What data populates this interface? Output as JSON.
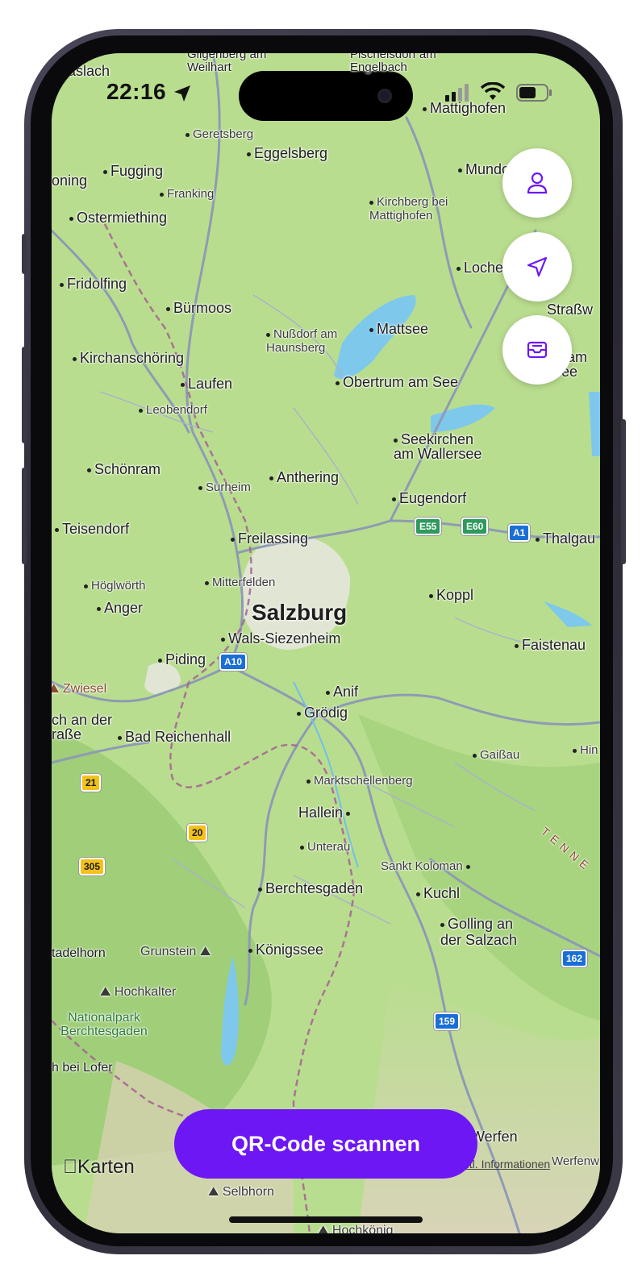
{
  "status_bar": {
    "time": "22:16"
  },
  "map": {
    "main_city": "Salzburg",
    "places": [
      {
        "name": "Mattighofen"
      },
      {
        "name": "Geretsberg"
      },
      {
        "name": "Eggelsberg"
      },
      {
        "name": "Fugging"
      },
      {
        "name": "Franking"
      },
      {
        "name": "Ostermiething"
      },
      {
        "name": "Kirchberg bei Mattighofen"
      },
      {
        "name": "Fridolfing"
      },
      {
        "name": "Bürmoos"
      },
      {
        "name": "Nußdorf am Haunsberg"
      },
      {
        "name": "Mattsee"
      },
      {
        "name": "Kirchanschöring"
      },
      {
        "name": "Laufen"
      },
      {
        "name": "Obertrum am See"
      },
      {
        "name": "Leobendorf"
      },
      {
        "name": "Seekirchen am Wallersee"
      },
      {
        "name": "Schönram"
      },
      {
        "name": "Surheim"
      },
      {
        "name": "Anthering"
      },
      {
        "name": "Eugendorf"
      },
      {
        "name": "Teisendorf"
      },
      {
        "name": "Freilassing"
      },
      {
        "name": "Thalgau"
      },
      {
        "name": "Höglwörth"
      },
      {
        "name": "Mitterfelden"
      },
      {
        "name": "Koppl"
      },
      {
        "name": "Anger"
      },
      {
        "name": "Wals-Siezenheim"
      },
      {
        "name": "Faistenau"
      },
      {
        "name": "Piding"
      },
      {
        "name": "Anif"
      },
      {
        "name": "Grödig"
      },
      {
        "name": "Bad Reichenhall"
      },
      {
        "name": "Gaißau"
      },
      {
        "name": "Marktschellenberg"
      },
      {
        "name": "Hallein"
      },
      {
        "name": "Unterau"
      },
      {
        "name": "Sankt Koloman"
      },
      {
        "name": "Berchtesgaden"
      },
      {
        "name": "Kuchl"
      },
      {
        "name": "Golling an der Salzach"
      },
      {
        "name": "Königssee"
      },
      {
        "name": "Werfen"
      }
    ],
    "peaks": [
      "Zwiesel",
      "Grunstein",
      "Hochkalter",
      "Selbhorn",
      "Hochkönig"
    ],
    "edge_labels": [
      "aslach",
      "oning",
      "Mundo",
      "Loche",
      "Straßw",
      "kt am See",
      "Hin",
      "ch an der raße",
      "tadelhorn",
      "h bei Lofer",
      "Werfenw",
      "Gilgenberg am Weilhart",
      "Pischelsdorf am Engelbach"
    ],
    "park": "Nationalpark Berchtesgaden",
    "mountain_range": "TENNE",
    "road_shields": [
      "E55",
      "E60",
      "A1",
      "A10",
      "21",
      "20",
      "305",
      "162",
      "159"
    ]
  },
  "controls": {
    "profile_icon": "person-icon",
    "locate_icon": "location-arrow-icon",
    "inbox_icon": "tray-icon"
  },
  "footer": {
    "maps_brand": "Karten",
    "legal_text": "ntl. Informationen",
    "qr_button_label": "QR-Code scannen"
  },
  "colors": {
    "accent": "#6d17f5",
    "map_green": "#b9dd8f"
  }
}
